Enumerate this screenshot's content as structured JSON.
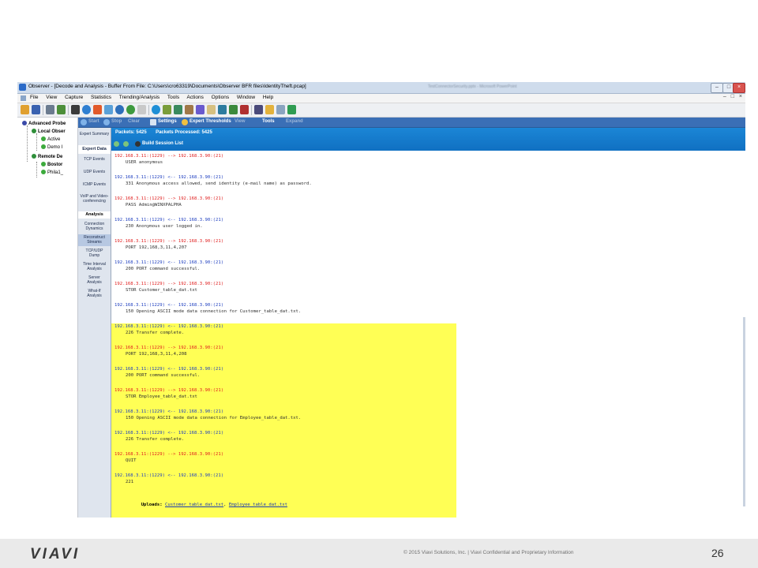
{
  "window": {
    "title": "Observer - [Decode and Analysis - Buffer From File: C:\\Users\\cro63319\\Documents\\Observer BFR files\\IdentityTheft.pcap]",
    "background_tab_text": "TestConnectorSecurity.pptx - Microsoft PowerPoint",
    "minimize": "–",
    "maximize": "□",
    "close": "×"
  },
  "menubar": {
    "items": [
      "File",
      "View",
      "Capture",
      "Statistics",
      "Trending/Analysis",
      "Tools",
      "Actions",
      "Options",
      "Window",
      "Help"
    ],
    "mdi_controls": "– □ ×"
  },
  "tree": {
    "advanced_probe": "Advanced Probe",
    "local_observer": "Local Obser",
    "active": "Active",
    "demo": "Demo I",
    "remote": "Remote De",
    "boston": "Bostor",
    "phila": "Phila1_"
  },
  "pane_toolbar": {
    "start": "Start",
    "stop": "Stop",
    "clear": "Clear",
    "settings": "Settings",
    "expert_thresholds": "Expert Thresholds",
    "view": "View",
    "tools": "Tools",
    "expand": "Expand"
  },
  "nav": {
    "expert_summary": "Expert Summary",
    "expert_data": "Expert Data",
    "tcp_events": "TCP Events",
    "udp_events": "UDP Events",
    "icmp_events": "ICMP Events",
    "voip": "VoIP and Video-conferencing",
    "analysis": "Analysis",
    "connection_dynamics": "Connection Dynamics",
    "reconstruct_streams": "Reconstruct Streams",
    "tcp_udp_dump": "TCP/UDP Dump",
    "time_interval": "Time Interval Analysis",
    "server_analysis": "Server Analysis",
    "what_if": "What-If Analysis"
  },
  "stats": {
    "packets_label": "Packets:",
    "packets_value": "5425",
    "processed_label": "Packets Processed:",
    "processed_value": "5425",
    "build_session_list": "Build Session List"
  },
  "decode": {
    "entries": [
      {
        "dir": "out",
        "header": "192.168.3.11:(1229) --> 192.168.3.90:(21)",
        "body": "USER anonymous"
      },
      {
        "dir": "in",
        "header": "192.168.3.11:(1229) <-- 192.168.3.90:(21)",
        "body": "331 Anonymous access allowed, send identity (e-mail name) as password."
      },
      {
        "dir": "out",
        "header": "192.168.3.11:(1229) --> 192.168.3.90:(21)",
        "body": "PASS Admin@WINXPALPHA"
      },
      {
        "dir": "in",
        "header": "192.168.3.11:(1229) <-- 192.168.3.90:(21)",
        "body": "230 Anonymous user logged in."
      },
      {
        "dir": "out",
        "header": "192.168.3.11:(1229) --> 192.168.3.90:(21)",
        "body": "PORT 192,168,3,11,4,207"
      },
      {
        "dir": "in",
        "header": "192.168.3.11:(1229) <-- 192.168.3.90:(21)",
        "body": "200 PORT command successful."
      },
      {
        "dir": "out",
        "header": "192.168.3.11:(1229) --> 192.168.3.90:(21)",
        "body": "STOR Customer_table_dat.txt"
      },
      {
        "dir": "in",
        "header": "192.168.3.11:(1229) <-- 192.168.3.90:(21)",
        "body": "150 Opening ASCII mode data connection for Customer_table_dat.txt."
      },
      {
        "dir": "in",
        "header": "192.168.3.11:(1229) <-- 192.168.3.90:(21)",
        "body": "226 Transfer complete."
      },
      {
        "dir": "out",
        "header": "192.168.3.11:(1229) --> 192.168.3.90:(21)",
        "body": "PORT 192,168,3,11,4,208"
      },
      {
        "dir": "in",
        "header": "192.168.3.11:(1229) <-- 192.168.3.90:(21)",
        "body": "200 PORT command successful."
      },
      {
        "dir": "out",
        "header": "192.168.3.11:(1229) --> 192.168.3.90:(21)",
        "body": "STOR Employee_table_dat.txt"
      },
      {
        "dir": "in",
        "header": "192.168.3.11:(1229) <-- 192.168.3.90:(21)",
        "body": "150 Opening ASCII mode data connection for Employee_table_dat.txt."
      },
      {
        "dir": "in",
        "header": "192.168.3.11:(1229) <-- 192.168.3.90:(21)",
        "body": "226 Transfer complete."
      },
      {
        "dir": "out",
        "header": "192.168.3.11:(1229) --> 192.168.3.90:(21)",
        "body": "QUIT"
      },
      {
        "dir": "in",
        "header": "192.168.3.11:(1229) <-- 192.168.3.90:(21)",
        "body": "221"
      }
    ],
    "uploads_label": "Uploads:",
    "upload_1": "Customer_table_dat.txt",
    "upload_sep": ", ",
    "upload_2": "Employee_table_dat.txt"
  },
  "colors": {
    "outbound": "#e02020",
    "inbound": "#2040c0",
    "highlight": "#ffff55",
    "stats_bar": "#1b86d6"
  },
  "footer": {
    "logo": "VIAVI",
    "copyright": "© 2015 Viavi Solutions, Inc. | Viavi Confidential and Proprietary Information",
    "page_number": "26"
  }
}
